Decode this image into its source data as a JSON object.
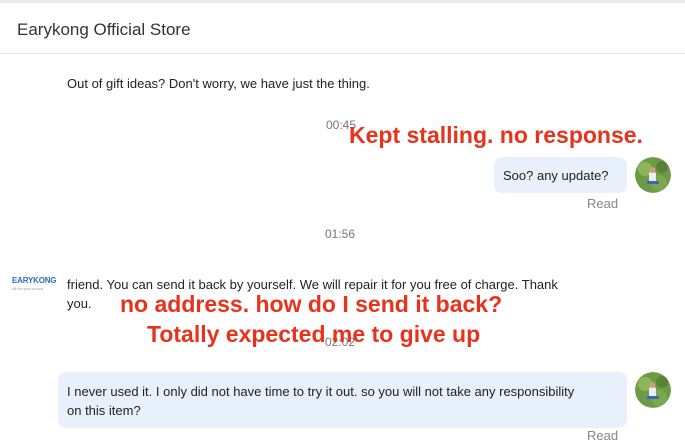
{
  "header": {
    "title": "Earykong Official Store"
  },
  "messages": {
    "m1": "Out of gift ideas? Don't worry, we have just the thing.",
    "ts1": "00:45",
    "m2": "Soo? any update?",
    "m2_status": "Read",
    "ts2": "01:56",
    "m3_line1": "friend. You can send it back by yourself. We will repair it for you free of charge. Thank",
    "m3_line2": "you.",
    "ts3": "02:02",
    "m4_line1": "I never used it. I only did not have time to try it out. so you will not take any responsibility",
    "m4_line2": "on this item?",
    "m4_status": "Read"
  },
  "annotations": {
    "a1": "Kept stalling. no response.",
    "a2": "no address. how do I send it back?",
    "a3": "Totally expected me to give up"
  },
  "store_logo": {
    "text": "EARYKONG",
    "subtext": "All for your sound"
  },
  "colors": {
    "annotation": "#e8321c",
    "bubble": "#e8f1fb",
    "logo": "#2a6fc1"
  },
  "icons": {
    "store_logo": "earykong-logo-icon",
    "user_avatar": "user-avatar-icon"
  }
}
